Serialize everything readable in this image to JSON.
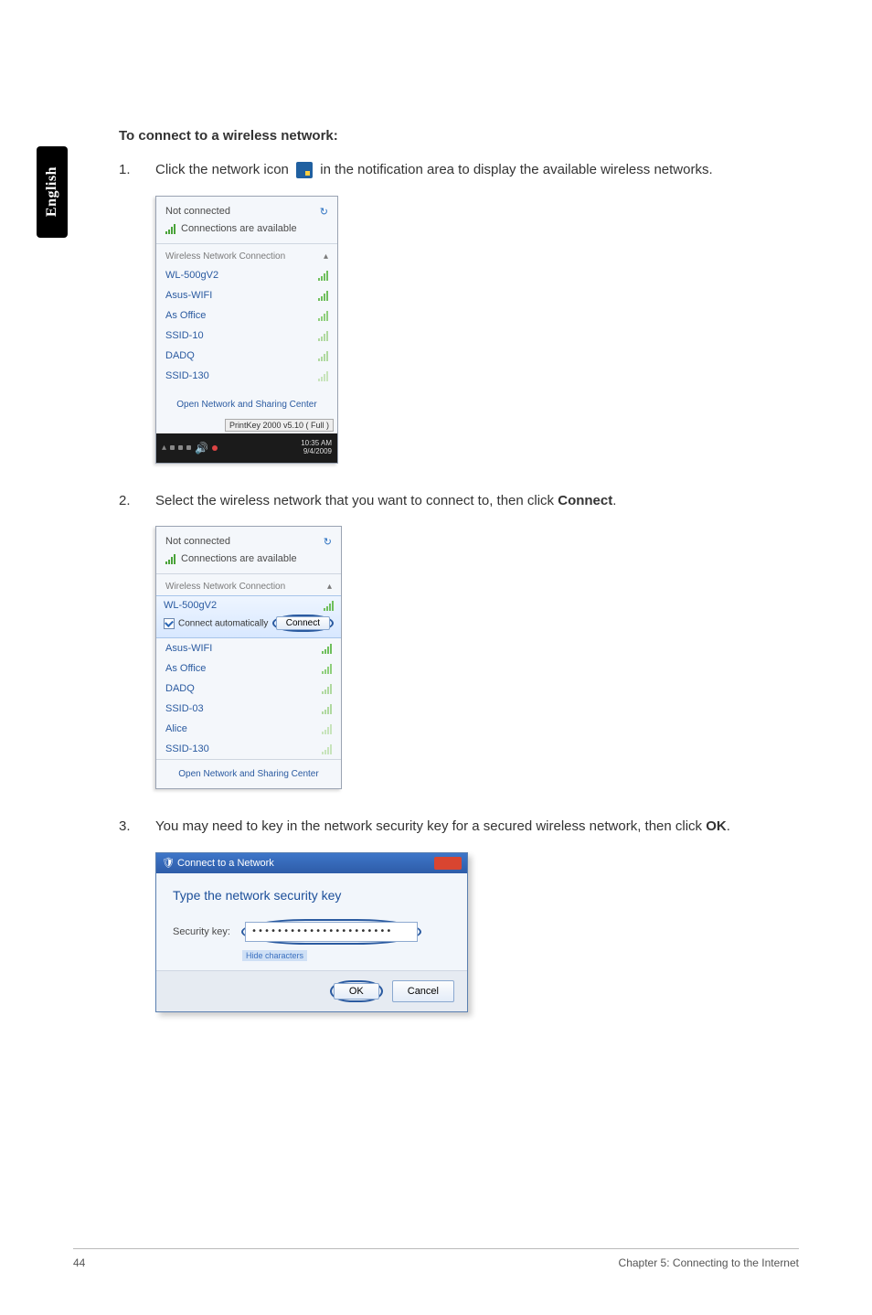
{
  "sideTab": "English",
  "heading": "To connect to a wireless network:",
  "step1": {
    "num": "1.",
    "pre": "Click the network icon ",
    "post": " in the notification area to display the available wireless networks."
  },
  "popup1": {
    "status": "Not connected",
    "avail": "Connections are available",
    "sectionLabel": "Wireless Network Connection",
    "networks": [
      {
        "name": "WL-500gV2"
      },
      {
        "name": "Asus-WIFI"
      },
      {
        "name": "As Office"
      },
      {
        "name": "SSID-10"
      },
      {
        "name": "DADQ"
      },
      {
        "name": "SSID-130"
      }
    ],
    "footerLink": "Open Network and Sharing Center",
    "tooltip": "PrintKey 2000 v5.10 ( Full )",
    "time": "10:35 AM",
    "date": "9/4/2009"
  },
  "step2": {
    "num": "2.",
    "pre": "Select the wireless network that you want to connect to, then click ",
    "bold": "Connect",
    "post": "."
  },
  "popup2": {
    "status": "Not connected",
    "avail": "Connections are available",
    "sectionLabel": "Wireless Network Connection",
    "selectedName": "WL-500gV2",
    "autoConnect": "Connect automatically",
    "connectBtn": "Connect",
    "networks": [
      {
        "name": "Asus-WIFI"
      },
      {
        "name": "As Office"
      },
      {
        "name": "DADQ"
      },
      {
        "name": "SSID-03"
      },
      {
        "name": "Alice"
      },
      {
        "name": "SSID-130"
      }
    ],
    "footerLink": "Open Network and Sharing Center"
  },
  "step3": {
    "num": "3.",
    "pre": "You may need to key in the network security key for a secured wireless network, then click ",
    "bold": "OK",
    "post": "."
  },
  "dialog": {
    "title": "Connect to a Network",
    "prompt": "Type the network security key",
    "fieldLabel": "Security key:",
    "fieldValue": "••••••••••••••••••••••",
    "hideChars": "Hide characters",
    "okBtn": "OK",
    "cancelBtn": "Cancel"
  },
  "footer": {
    "pageNum": "44",
    "chapter": "Chapter 5: Connecting to the Internet"
  }
}
